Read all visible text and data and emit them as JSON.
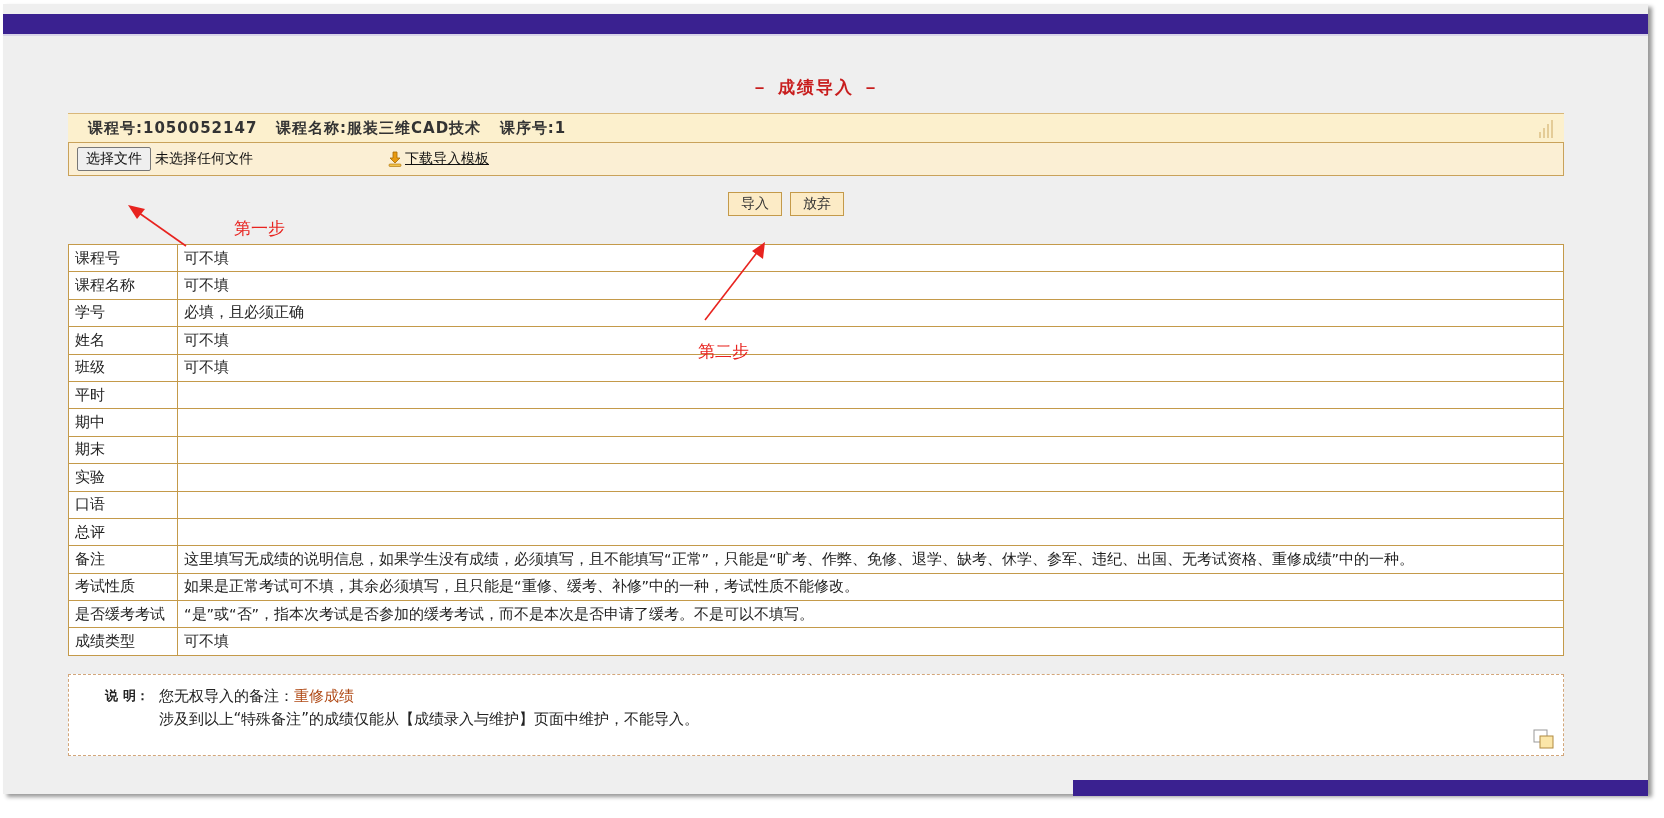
{
  "title": "－ 成绩导入 －",
  "course_info": "课程号:1050052147   课程名称:服装三维CAD技术   课序号:1",
  "file_picker": {
    "button": "选择文件",
    "status": "未选择任何文件"
  },
  "download_link": "下载导入模板",
  "actions": [
    "导入",
    "放弃"
  ],
  "table": {
    "rows": [
      {
        "field": "课程号",
        "rule": "可不填"
      },
      {
        "field": "课程名称",
        "rule": "可不填"
      },
      {
        "field": "学号",
        "rule": "必填，且必须正确"
      },
      {
        "field": "姓名",
        "rule": "可不填"
      },
      {
        "field": "班级",
        "rule": "可不填"
      },
      {
        "field": "平时"
      },
      {
        "field": "期中"
      },
      {
        "field": "期末"
      },
      {
        "field": "实验"
      },
      {
        "field": "口语"
      },
      {
        "field": "总评"
      },
      {
        "field": "备注",
        "rule": "这里填写无成绩的说明信息，如果学生没有成绩，必须填写，且不能填写“正常”，只能是“旷考、作弊、免修、退学、缺考、休学、参军、违纪、出国、无考试资格、重修成绩”中的一种。"
      },
      {
        "field": "考试性质",
        "rule": "如果是正常考试可不填，其余必须填写，且只能是“重修、缓考、补修”中的一种，考试性质不能修改。"
      },
      {
        "field": "是否缓考考试",
        "rule": "“是”或“否”，指本次考试是否参加的缓考考试，而不是本次是否申请了缓考。不是可以不填写。"
      },
      {
        "field": "成绩类型",
        "rule": "可不填"
      }
    ]
  },
  "note": {
    "label": "说 明：",
    "prefix": "您无权导入的备注：",
    "restricted": "重修成绩",
    "detail": "涉及到以上“特殊备注”的成绩仅能从【成绩录入与维护】页面中维护，不能导入。"
  },
  "annotations": [
    {
      "text": "第一步"
    },
    {
      "text": "第二步"
    }
  ]
}
